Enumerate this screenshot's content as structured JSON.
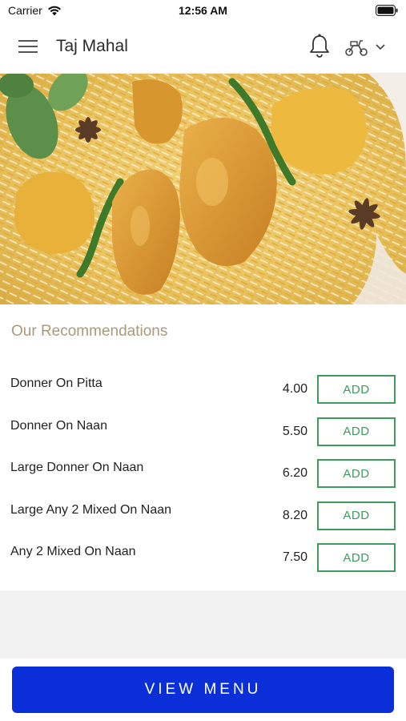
{
  "status_bar": {
    "carrier": "Carrier",
    "time": "12:56 AM"
  },
  "header": {
    "title": "Taj Mahal",
    "menu_icon": "hamburger-icon",
    "bell_icon": "bell-icon",
    "delivery_icon": "scooter-icon",
    "chevron_icon": "chevron-down-icon"
  },
  "section": {
    "title": "Our Recommendations"
  },
  "items": [
    {
      "name": "Donner On Pitta",
      "price": "4.00",
      "add": "ADD"
    },
    {
      "name": "Donner On Naan",
      "price": "5.50",
      "add": "ADD"
    },
    {
      "name": "Large Donner On Naan",
      "price": "6.20",
      "add": "ADD"
    },
    {
      "name": "Large Any 2 Mixed On Naan",
      "price": "8.20",
      "add": "ADD"
    },
    {
      "name": "Any 2 Mixed On Naan",
      "price": "7.50",
      "add": "ADD"
    }
  ],
  "footer": {
    "view_menu": "VIEW MENU"
  },
  "colors": {
    "add_green": "#3f9a5d",
    "view_menu_blue": "#0a2fd8",
    "section_title": "#a89a7a"
  }
}
